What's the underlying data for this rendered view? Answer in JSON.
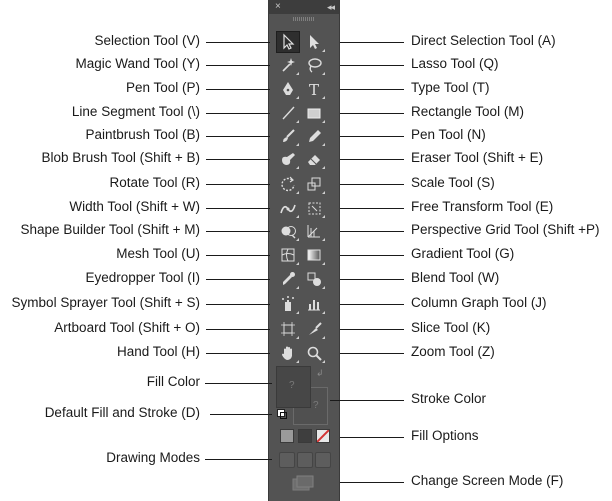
{
  "panel": {
    "close_glyph": "×",
    "collapse_glyph": "◂◂",
    "fill_placeholder": "?",
    "stroke_placeholder": "?"
  },
  "tools": [
    {
      "row": 0,
      "left": {
        "name": "selection-tool",
        "icon": "selection-arrow-icon"
      },
      "right": {
        "name": "direct-selection-tool",
        "icon": "direct-selection-arrow-icon"
      }
    },
    {
      "row": 1,
      "left": {
        "name": "magic-wand-tool",
        "icon": "magic-wand-icon"
      },
      "right": {
        "name": "lasso-tool",
        "icon": "lasso-icon"
      }
    },
    {
      "row": 2,
      "left": {
        "name": "pen-tool",
        "icon": "pen-nib-icon"
      },
      "right": {
        "name": "type-tool",
        "icon": "type-t-icon"
      }
    },
    {
      "row": 3,
      "left": {
        "name": "line-segment-tool",
        "icon": "line-segment-icon"
      },
      "right": {
        "name": "rectangle-tool",
        "icon": "rectangle-icon"
      }
    },
    {
      "row": 4,
      "left": {
        "name": "paintbrush-tool",
        "icon": "paintbrush-icon"
      },
      "right": {
        "name": "pencil-tool",
        "icon": "pencil-icon"
      }
    },
    {
      "row": 5,
      "left": {
        "name": "blob-brush-tool",
        "icon": "blob-brush-icon"
      },
      "right": {
        "name": "eraser-tool",
        "icon": "eraser-icon"
      }
    },
    {
      "row": 6,
      "left": {
        "name": "rotate-tool",
        "icon": "rotate-icon"
      },
      "right": {
        "name": "scale-tool",
        "icon": "scale-icon"
      }
    },
    {
      "row": 7,
      "left": {
        "name": "width-tool",
        "icon": "width-icon"
      },
      "right": {
        "name": "free-transform-tool",
        "icon": "free-transform-icon"
      }
    },
    {
      "row": 8,
      "left": {
        "name": "shape-builder-tool",
        "icon": "shape-builder-icon"
      },
      "right": {
        "name": "perspective-grid-tool",
        "icon": "perspective-grid-icon"
      }
    },
    {
      "row": 9,
      "left": {
        "name": "mesh-tool",
        "icon": "mesh-icon"
      },
      "right": {
        "name": "gradient-tool",
        "icon": "gradient-icon"
      }
    },
    {
      "row": 10,
      "left": {
        "name": "eyedropper-tool",
        "icon": "eyedropper-icon"
      },
      "right": {
        "name": "blend-tool",
        "icon": "blend-icon"
      }
    },
    {
      "row": 11,
      "left": {
        "name": "symbol-sprayer-tool",
        "icon": "symbol-sprayer-icon"
      },
      "right": {
        "name": "column-graph-tool",
        "icon": "column-graph-icon"
      }
    },
    {
      "row": 12,
      "left": {
        "name": "artboard-tool",
        "icon": "artboard-icon"
      },
      "right": {
        "name": "slice-tool",
        "icon": "slice-knife-icon"
      }
    },
    {
      "row": 13,
      "left": {
        "name": "hand-tool",
        "icon": "hand-icon"
      },
      "right": {
        "name": "zoom-tool",
        "icon": "magnifier-icon"
      }
    }
  ],
  "labels_left": [
    "Selection Tool (V)",
    "Magic Wand Tool (Y)",
    "Pen Tool (P)",
    "Line Segment Tool (\\)",
    "Paintbrush Tool (B)",
    "Blob Brush Tool (Shift + B)",
    "Rotate Tool (R)",
    "Width Tool (Shift + W)",
    "Shape Builder Tool (Shift + M)",
    "Mesh Tool (U)",
    "Eyedropper Tool (I)",
    "Symbol Sprayer Tool (Shift + S)",
    "Artboard Tool (Shift + O)",
    "Hand Tool (H)",
    "Fill Color",
    "Default Fill and Stroke (D)",
    "Drawing Modes"
  ],
  "labels_right": [
    "Direct Selection Tool (A)",
    "Lasso Tool (Q)",
    "Type Tool (T)",
    "Rectangle Tool (M)",
    "Pen Tool (N)",
    "Eraser Tool (Shift + E)",
    "Scale Tool (S)",
    "Free Transform Tool (E)",
    "Perspective Grid Tool (Shift +P)",
    "Gradient Tool (G)",
    "Blend Tool (W)",
    "Column Graph Tool (J)",
    "Slice Tool (K)",
    "Zoom Tool (Z)",
    "Stroke Color",
    "Fill Options",
    "Change Screen Mode (F)"
  ],
  "colors": {
    "panel": "#535353",
    "panel_header": "#3d3d3d",
    "icon": "#d6d6d6",
    "label_text": "#1a1a1a",
    "none_swatch_slash": "#d33333"
  }
}
